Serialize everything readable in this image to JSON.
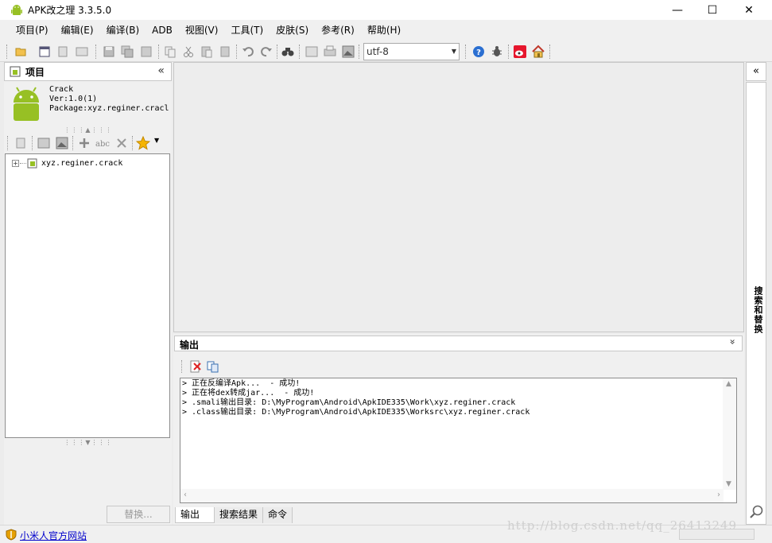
{
  "window": {
    "title": "APK改之理 3.3.5.0",
    "min_glyph": "—",
    "max_glyph": "☐",
    "close_glyph": "✕"
  },
  "menu": [
    "项目(P)",
    "编辑(E)",
    "编译(B)",
    "ADB",
    "视图(V)",
    "工具(T)",
    "皮肤(S)",
    "参考(R)",
    "帮助(H)"
  ],
  "toolbar": {
    "encoding": "utf-8"
  },
  "project": {
    "header": "项目",
    "collapse_glyph": "«",
    "app_name": "Crack",
    "version": "Ver:1.0(1)",
    "package": "Package:xyz.reginer.cracl",
    "tree_root": "xyz.reginer.crack",
    "replace_button": "替换..."
  },
  "output": {
    "header": "输出",
    "collapse_glyph": "»",
    "lines": [
      "> 正在反编译Apk...  - 成功!",
      "> 正在将dex转成jar...  - 成功!",
      "> .smali输出目录: D:\\MyProgram\\Android\\ApkIDE335\\Work\\xyz.reginer.crack",
      "> .class输出目录: D:\\MyProgram\\Android\\ApkIDE335\\Worksrc\\xyz.reginer.crack"
    ],
    "tabs": [
      "输出",
      "搜索结果",
      "命令"
    ]
  },
  "side": {
    "collapse_glyph": "«",
    "vertical_label": "搜索和替换"
  },
  "status": {
    "link": "小米人官方网站"
  },
  "watermark": "http://blog.csdn.net/qq_26413249",
  "colors": {
    "android_green": "#97c024",
    "link_blue": "#0000cc"
  }
}
